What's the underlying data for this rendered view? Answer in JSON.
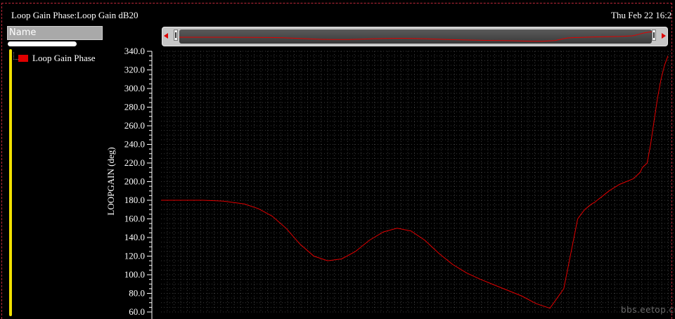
{
  "window": {
    "title": "Loop Gain Phase:Loop Gain dB20",
    "timestamp": "Thu Feb 22 16:2"
  },
  "sidebar": {
    "header": "Name",
    "items": [
      {
        "label": "Loop Gain Phase",
        "color": "#e00000"
      }
    ]
  },
  "watermark": "bbs.eetop.cn",
  "colors": {
    "trace": "#e00000",
    "background": "#000000",
    "grid": "#3a3a3a",
    "axis": "#ffffff"
  },
  "chart_data": {
    "type": "line",
    "ylabel": "LOOPGAIN (deg)",
    "ylim": [
      60,
      340
    ],
    "yticks": [
      "340.0",
      "320.0",
      "300.0",
      "280.0",
      "260.0",
      "240.0",
      "220.0",
      "200.0",
      "180.0",
      "160.0",
      "140.0",
      "120.0",
      "100.0",
      "80.0",
      "60.0"
    ],
    "grid": true,
    "series": [
      {
        "name": "Loop Gain Phase",
        "x": [
          0,
          20,
          40,
          60,
          80,
          90,
          100,
          120,
          140,
          160,
          180,
          200,
          220,
          240,
          260,
          280,
          300,
          320,
          340,
          360,
          380,
          400,
          420,
          440,
          460,
          480,
          500,
          520,
          540,
          560,
          580,
          600,
          610,
          620,
          625,
          628,
          635,
          645,
          660,
          680,
          690,
          693,
          700,
          705,
          710,
          715,
          720,
          725,
          730
        ],
        "y": [
          180,
          180,
          180,
          180,
          179.5,
          179,
          178,
          176,
          171,
          163,
          150,
          133,
          120,
          115,
          117,
          125,
          137,
          146,
          150,
          147,
          137,
          123,
          111,
          102,
          95,
          89,
          83,
          77,
          69,
          64,
          85,
          160,
          170,
          176,
          178,
          180,
          184,
          190,
          197,
          203,
          210,
          215,
          220,
          240,
          265,
          290,
          310,
          325,
          335
        ]
      }
    ]
  }
}
